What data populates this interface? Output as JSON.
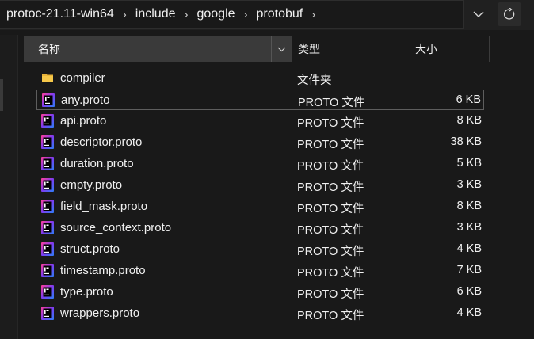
{
  "addressbar": {
    "path": [
      "protoc-21.11-win64",
      "include",
      "google",
      "protobuf"
    ],
    "separator": "›",
    "dropdown_icon": "chevron-down-icon",
    "refresh_icon": "refresh-icon"
  },
  "columns": {
    "name": "名称",
    "type": "类型",
    "size": "大小"
  },
  "files": [
    {
      "name": "compiler",
      "type": "文件夹",
      "size": "",
      "icon": "folder-icon"
    },
    {
      "name": "any.proto",
      "type": "PROTO 文件",
      "size": "6 KB",
      "icon": "proto-file-icon",
      "selected": true
    },
    {
      "name": "api.proto",
      "type": "PROTO 文件",
      "size": "8 KB",
      "icon": "proto-file-icon"
    },
    {
      "name": "descriptor.proto",
      "type": "PROTO 文件",
      "size": "38 KB",
      "icon": "proto-file-icon"
    },
    {
      "name": "duration.proto",
      "type": "PROTO 文件",
      "size": "5 KB",
      "icon": "proto-file-icon"
    },
    {
      "name": "empty.proto",
      "type": "PROTO 文件",
      "size": "3 KB",
      "icon": "proto-file-icon"
    },
    {
      "name": "field_mask.proto",
      "type": "PROTO 文件",
      "size": "8 KB",
      "icon": "proto-file-icon"
    },
    {
      "name": "source_context.proto",
      "type": "PROTO 文件",
      "size": "3 KB",
      "icon": "proto-file-icon"
    },
    {
      "name": "struct.proto",
      "type": "PROTO 文件",
      "size": "4 KB",
      "icon": "proto-file-icon"
    },
    {
      "name": "timestamp.proto",
      "type": "PROTO 文件",
      "size": "7 KB",
      "icon": "proto-file-icon"
    },
    {
      "name": "type.proto",
      "type": "PROTO 文件",
      "size": "6 KB",
      "icon": "proto-file-icon"
    },
    {
      "name": "wrappers.proto",
      "type": "PROTO 文件",
      "size": "4 KB",
      "icon": "proto-file-icon"
    }
  ]
}
